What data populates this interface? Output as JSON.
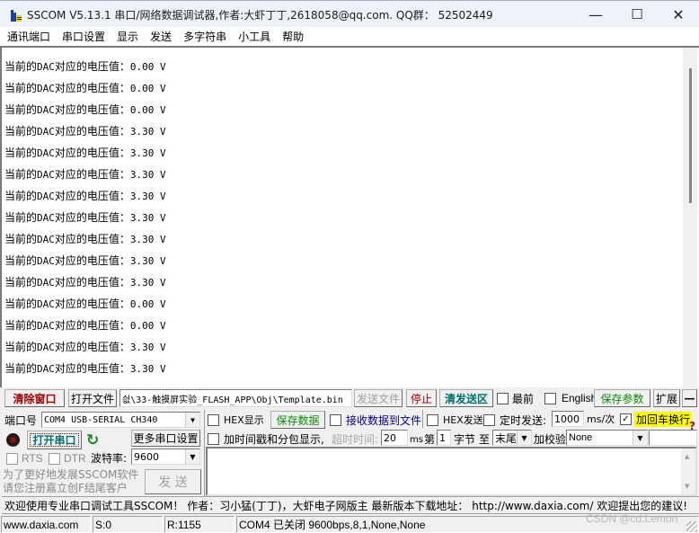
{
  "window": {
    "title": "SSCOM V5.13.1 串口/网络数据调试器,作者:大虾丁丁,2618058@qq.com. QQ群： 52502449",
    "controls": {
      "minimize": "—",
      "maximize": "☐",
      "close": "✕"
    }
  },
  "menu": [
    "通讯端口",
    "串口设置",
    "显示",
    "发送",
    "多字符串",
    "小工具",
    "帮助"
  ],
  "receive": {
    "prefix": "当前的",
    "label_mid": "DAC",
    "label_suffix": "对应的电压值：",
    "lines": [
      {
        "value": "0.00",
        "unit": "V"
      },
      {
        "value": "0.00",
        "unit": "V"
      },
      {
        "value": "0.00",
        "unit": "V"
      },
      {
        "value": "3.30",
        "unit": "V"
      },
      {
        "value": "3.30",
        "unit": "V"
      },
      {
        "value": "3.30",
        "unit": "V"
      },
      {
        "value": "3.30",
        "unit": "V"
      },
      {
        "value": "3.30",
        "unit": "V"
      },
      {
        "value": "3.30",
        "unit": "V"
      },
      {
        "value": "3.30",
        "unit": "V"
      },
      {
        "value": "3.30",
        "unit": "V"
      },
      {
        "value": "0.00",
        "unit": "V"
      },
      {
        "value": "0.00",
        "unit": "V"
      },
      {
        "value": "3.30",
        "unit": "V"
      },
      {
        "value": "3.30",
        "unit": "V"
      }
    ]
  },
  "toolbar": {
    "clear_window": "清除窗口",
    "open_file": "打开文件",
    "file_path": "싒\\33-触摸屏实验_FLASH_APP\\Obj\\Template.bin",
    "send_file": "发送文件",
    "stop": "停止",
    "clear_send": "清发送区",
    "topmost": "最前",
    "english": "English",
    "save_params": "保存参数",
    "expand": "扩展",
    "collapse": "—"
  },
  "port": {
    "port_label": "端口号",
    "port_value": "COM4 USB-SERIAL CH340",
    "open_port": "打开串口",
    "more_settings": "更多串口设置",
    "rts": "RTS",
    "dtr": "DTR",
    "baud_label": "波特率:",
    "baud_value": "9600",
    "promo_line1": "为了更好地发展SSCOM软件",
    "promo_line2": "请您注册嘉立创F结尾客户",
    "send_button": "发  送"
  },
  "options": {
    "hex_display": "HEX显示",
    "save_data": "保存数据",
    "recv_to_file": "接收数据到文件",
    "hex_send": "HEX发送",
    "timed_send": "定时发送:",
    "timed_interval": "1000",
    "timed_unit": "ms/次",
    "add_crlf": "加回车换行",
    "add_crlf_checked": true,
    "timestamp": "加时间戳和分包显示,",
    "timeout_label": "超时时间:",
    "timeout_value": "20",
    "timeout_unit": "ms",
    "byte_from_label": "第",
    "byte_from": "1",
    "byte_unit": "字节",
    "to_label": "至",
    "to_value": "末尾",
    "checksum_label": "加校验",
    "checksum_value": "None",
    "help": "?"
  },
  "ticker": "欢迎使用专业串口调试工具SSCOM！  作者：习小猛(丁丁)，大虾电子网版主  最新版本下载地址： http://www.daxia.com/ 欢迎提出您的建议!",
  "status": {
    "website": "www.daxia.com",
    "sent": "S:0",
    "received": "R:1155",
    "port_status": "COM4 已关闭  9600bps,8,1,None,None",
    "watermark": "CSDN @cd:Lemon"
  }
}
